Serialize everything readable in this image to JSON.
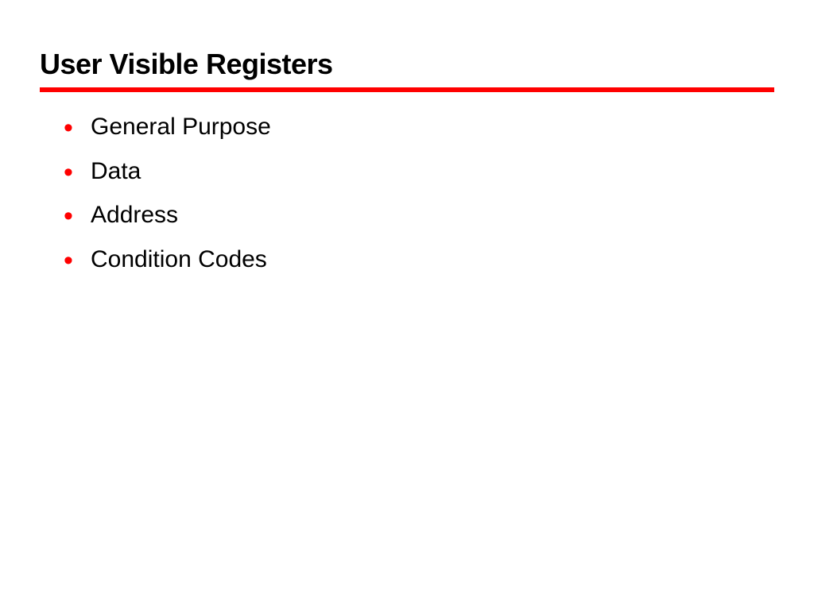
{
  "slide": {
    "title": "User Visible Registers",
    "bullets": [
      "General Purpose",
      "Data",
      "Address",
      "Condition Codes"
    ]
  }
}
